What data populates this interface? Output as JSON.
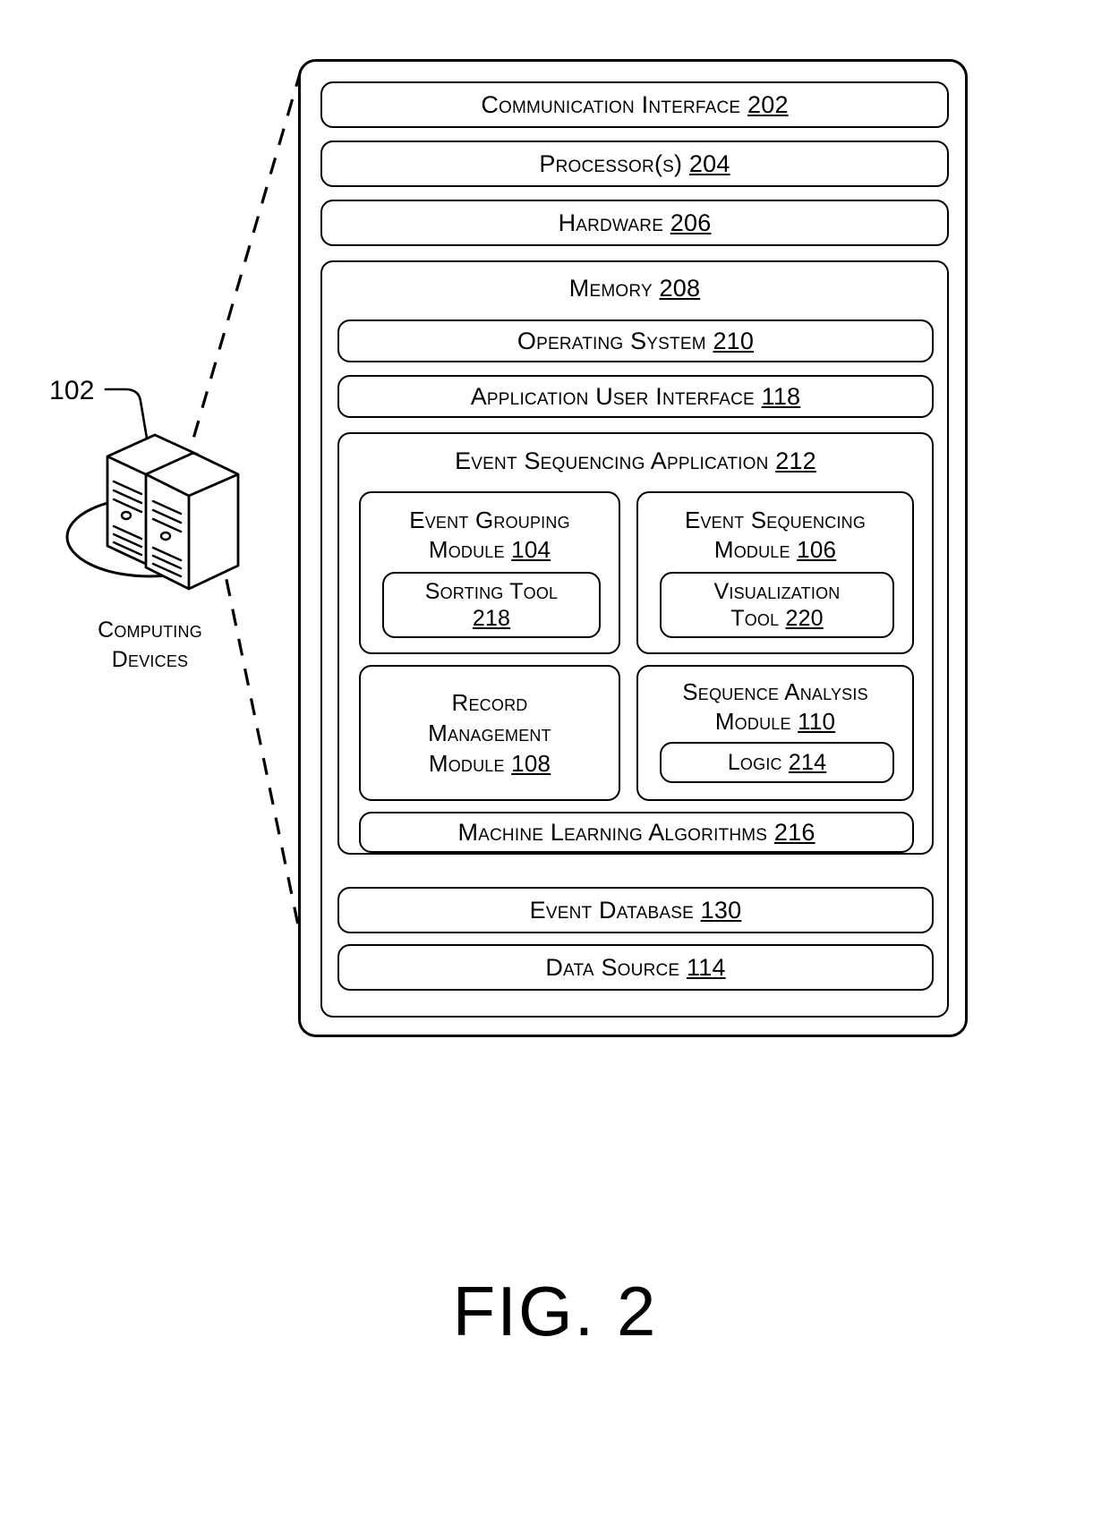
{
  "figure": {
    "caption": "FIG. 2"
  },
  "left": {
    "ref_number": "102",
    "caption_line1": "Computing",
    "caption_line2": "Devices",
    "icon": "server-tower-pair-icon"
  },
  "device": {
    "communication_interface": {
      "label": "Communication Interface",
      "ref": "202"
    },
    "processors": {
      "label": "Processor(s)",
      "ref": "204"
    },
    "hardware": {
      "label": "Hardware",
      "ref": "206"
    },
    "memory": {
      "label": "Memory",
      "ref": "208",
      "operating_system": {
        "label": "Operating System",
        "ref": "210"
      },
      "application_user_interface": {
        "label": "Application User Interface",
        "ref": "118"
      },
      "event_sequencing_application": {
        "label": "Event Sequencing Application",
        "ref": "212",
        "modules": [
          {
            "line1": "Event Grouping",
            "line2": "Module",
            "ref": "104",
            "child": {
              "line1": "Sorting Tool",
              "line2": "",
              "ref": "218"
            }
          },
          {
            "line1": "Event Sequencing",
            "line2": "Module",
            "ref": "106",
            "child": {
              "line1": "Visualization",
              "line2": "Tool",
              "ref": "220"
            }
          },
          {
            "line1": "Record",
            "line2": "Management",
            "line3": "Module",
            "ref": "108",
            "child": null
          },
          {
            "line1": "Sequence Analysis",
            "line2": "Module",
            "ref": "110",
            "child": {
              "line1": "Logic",
              "line2": "",
              "ref": "214"
            }
          }
        ],
        "machine_learning": {
          "label": "Machine Learning Algorithms",
          "ref": "216"
        }
      },
      "event_database": {
        "label": "Event Database",
        "ref": "130"
      },
      "data_source": {
        "label": "Data Source",
        "ref": "114"
      }
    }
  }
}
